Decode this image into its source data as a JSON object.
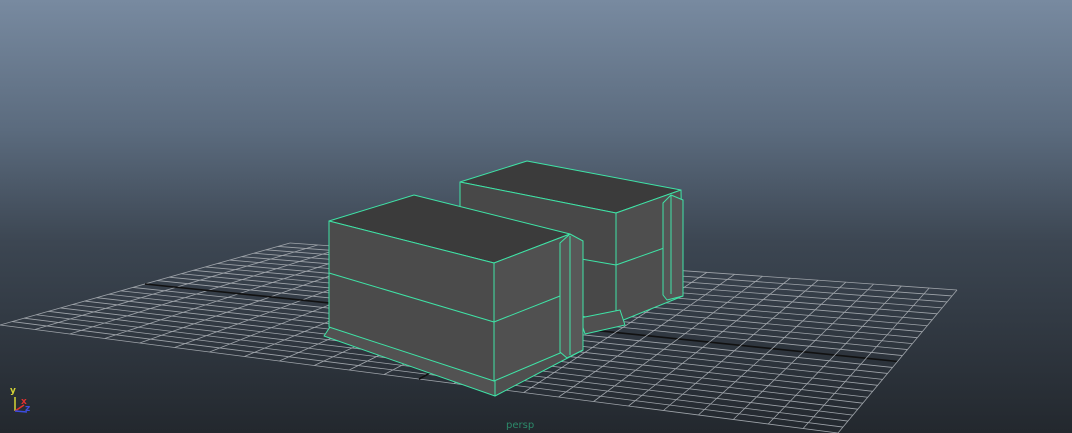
{
  "viewport": {
    "camera_name": "persp",
    "axis": {
      "y": "y",
      "x": "x",
      "z": "z"
    },
    "colors": {
      "selection_wireframe": "#3fe3a6",
      "mesh_fill_side": "#4a4a4a",
      "mesh_fill_top": "#3c3c3c",
      "grid_line": "#9fa4aa",
      "grid_axis": "#111111",
      "axis_x": "#e23030",
      "axis_y": "#d4d436",
      "axis_z": "#3d4de0"
    },
    "icons": [
      "axis-gizmo-icon"
    ]
  }
}
